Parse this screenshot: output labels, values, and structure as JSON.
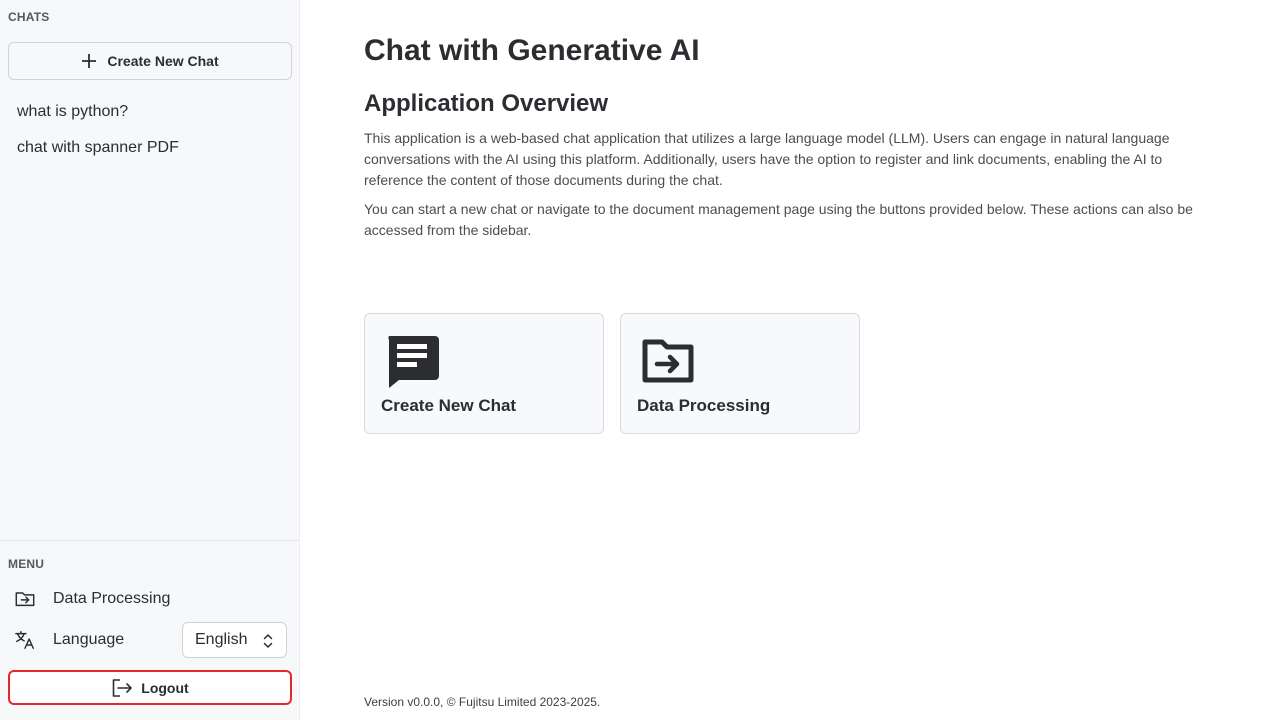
{
  "sidebar": {
    "chats_label": "CHATS",
    "new_chat_label": "Create New Chat",
    "chats": [
      {
        "title": "what is python?"
      },
      {
        "title": "chat with spanner PDF"
      }
    ],
    "menu_label": "MENU",
    "menu_items": [
      {
        "label": "Data Processing",
        "icon": "folder-arrow-icon"
      },
      {
        "label": "Language",
        "icon": "translate-icon"
      }
    ],
    "language_value": "English",
    "logout_label": "Logout"
  },
  "main": {
    "title": "Chat with Generative AI",
    "overview_title": "Application Overview",
    "paragraph1": "This application is a web-based chat application that utilizes a large language model (LLM). Users can engage in natural language conversations with the AI using this platform. Additionally, users have the option to register and link documents, enabling the AI to reference the content of those documents during the chat.",
    "paragraph2": "You can start a new chat or navigate to the document management page using the buttons provided below. These actions can also be accessed from the sidebar.",
    "cards": [
      {
        "label": "Create New Chat",
        "icon": "chat-icon"
      },
      {
        "label": "Data Processing",
        "icon": "folder-arrow-icon"
      }
    ],
    "version": "Version v0.0.0, © Fujitsu Limited 2023-2025."
  },
  "colors": {
    "sidebar_bg": "#f7f8fa",
    "text": "#2b2d31",
    "highlight": "#e8262b"
  }
}
